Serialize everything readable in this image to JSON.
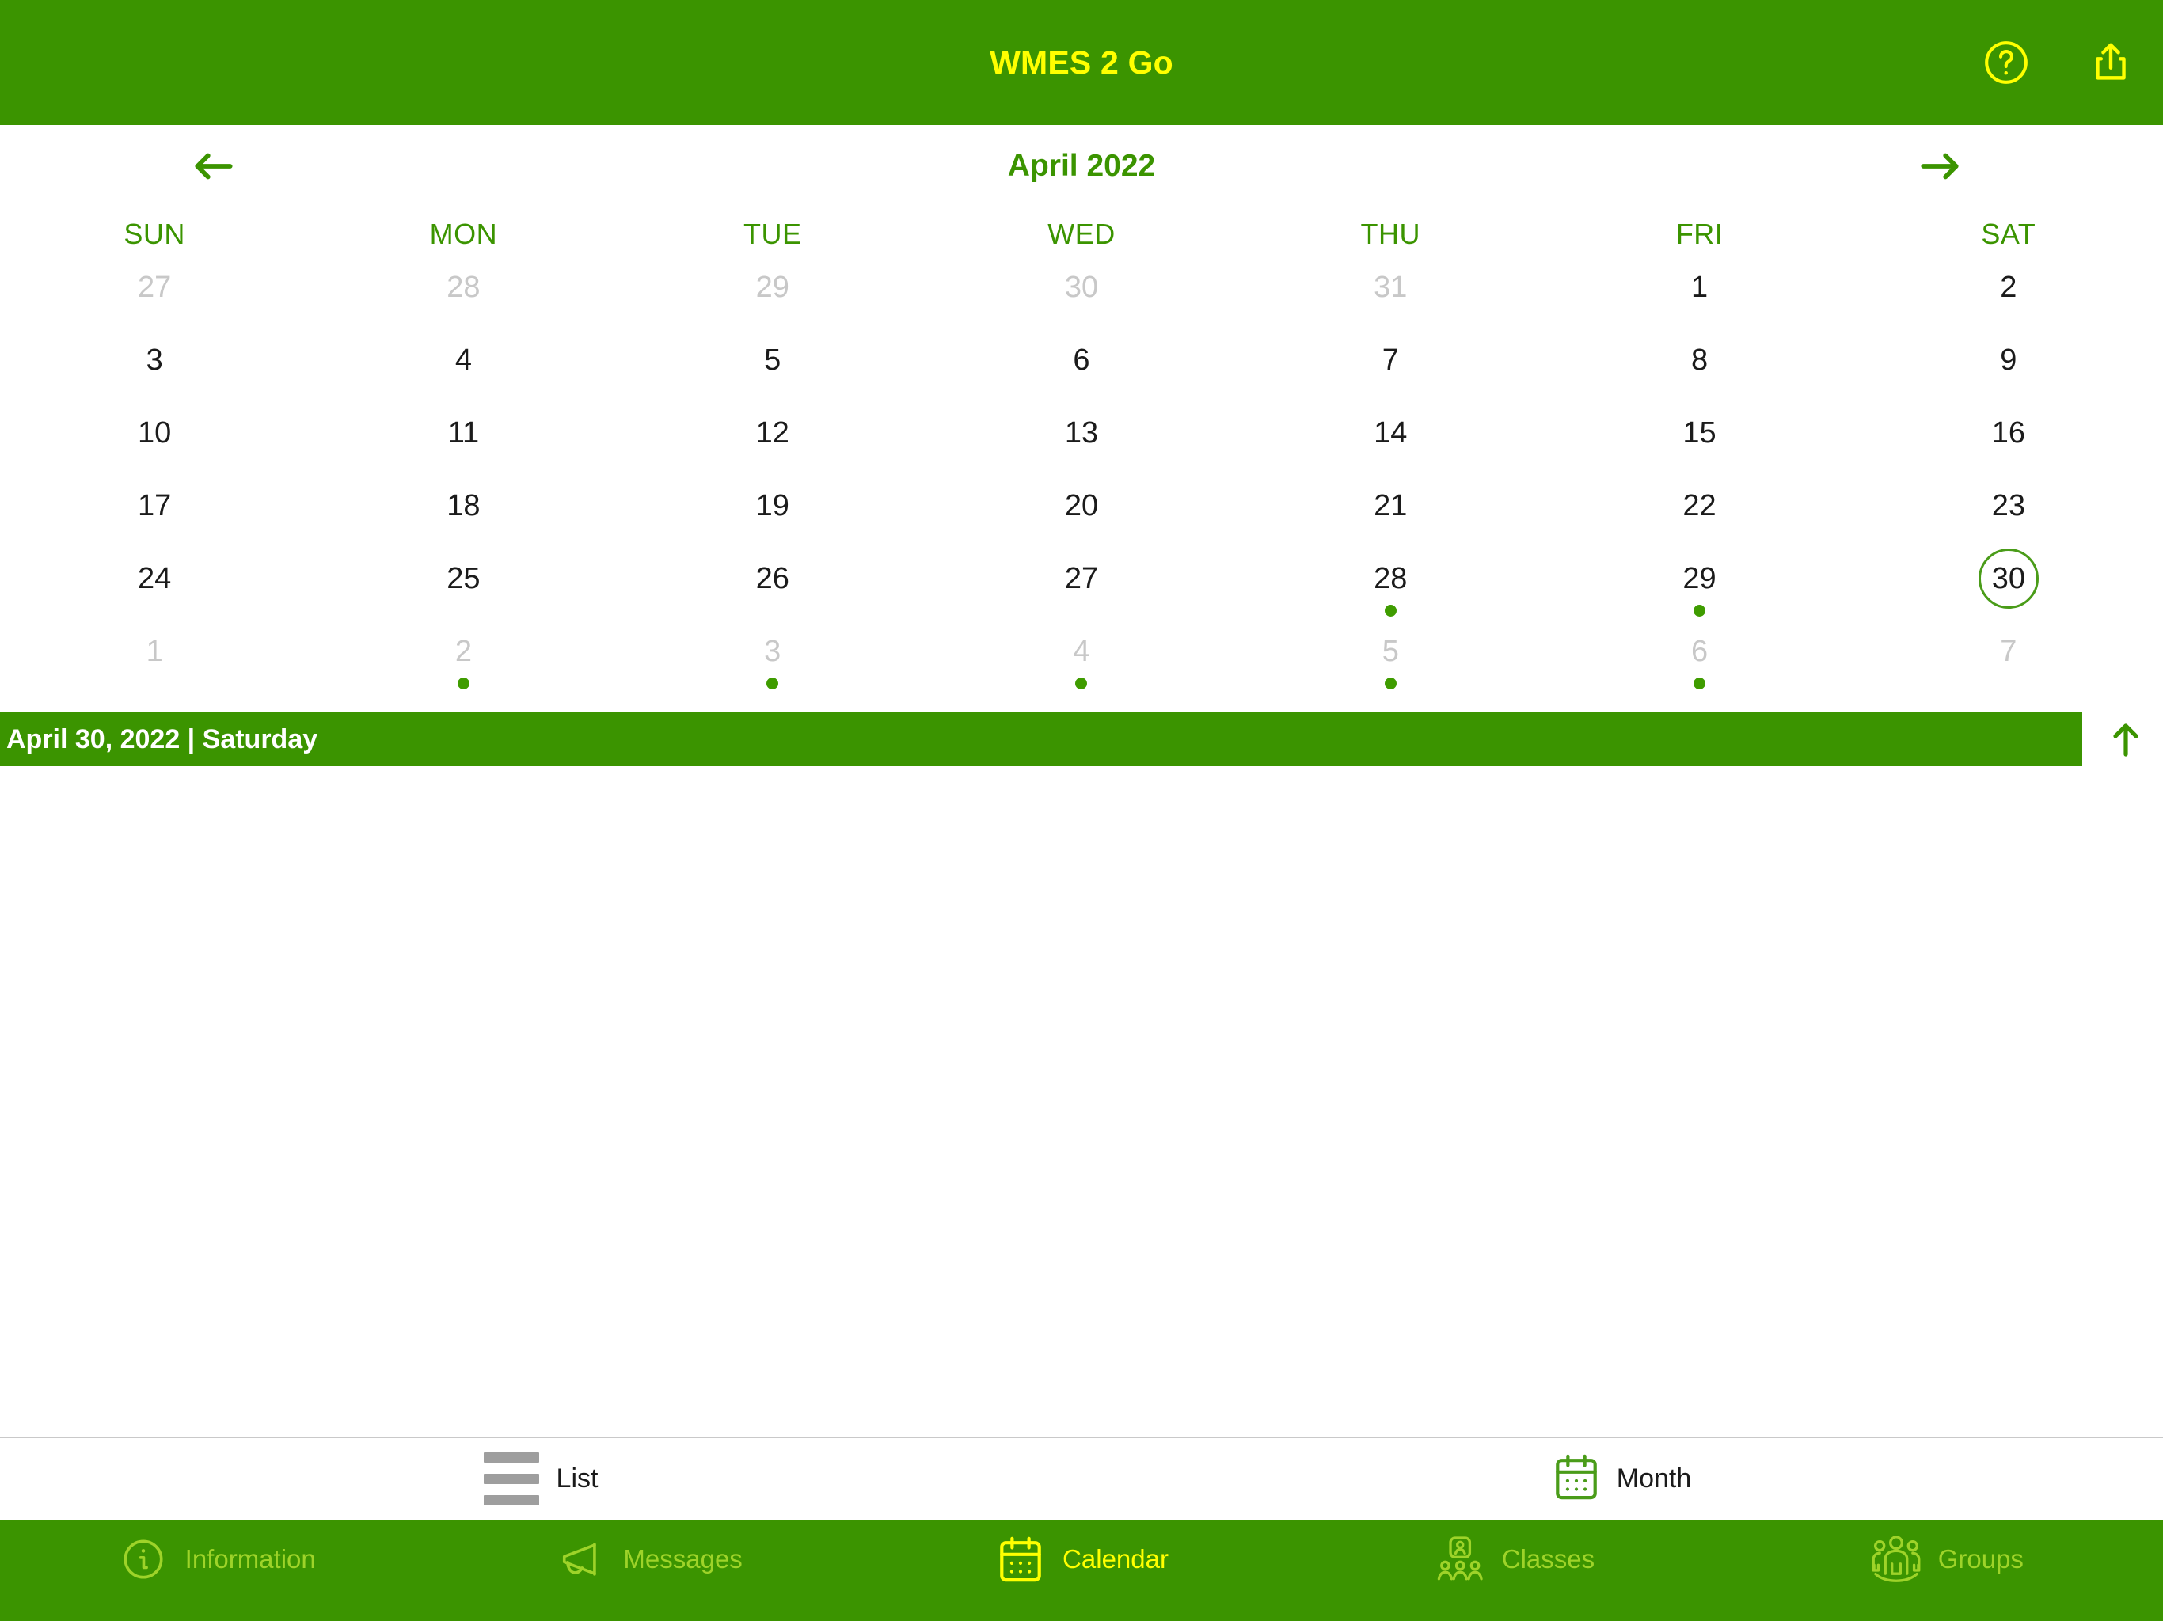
{
  "header": {
    "title": "WMES 2 Go",
    "help_icon": "question-circle-icon",
    "share_icon": "share-icon",
    "bg_color": "#3b9400",
    "text_color": "#ffff00"
  },
  "calendar": {
    "month_title": "April 2022",
    "prev_icon": "arrow-left-icon",
    "next_icon": "arrow-right-icon",
    "weekdays": [
      "SUN",
      "MON",
      "TUE",
      "WED",
      "THU",
      "FRI",
      "SAT"
    ],
    "accent_color": "#3b9400",
    "dot_color": "#3f9c00",
    "muted_color": "#c8c8c8",
    "days": [
      {
        "label": "27",
        "muted": true,
        "dot": false,
        "selected": false
      },
      {
        "label": "28",
        "muted": true,
        "dot": false,
        "selected": false
      },
      {
        "label": "29",
        "muted": true,
        "dot": false,
        "selected": false
      },
      {
        "label": "30",
        "muted": true,
        "dot": false,
        "selected": false
      },
      {
        "label": "31",
        "muted": true,
        "dot": false,
        "selected": false
      },
      {
        "label": "1",
        "muted": false,
        "dot": false,
        "selected": false
      },
      {
        "label": "2",
        "muted": false,
        "dot": false,
        "selected": false
      },
      {
        "label": "3",
        "muted": false,
        "dot": false,
        "selected": false
      },
      {
        "label": "4",
        "muted": false,
        "dot": false,
        "selected": false
      },
      {
        "label": "5",
        "muted": false,
        "dot": false,
        "selected": false
      },
      {
        "label": "6",
        "muted": false,
        "dot": false,
        "selected": false
      },
      {
        "label": "7",
        "muted": false,
        "dot": false,
        "selected": false
      },
      {
        "label": "8",
        "muted": false,
        "dot": false,
        "selected": false
      },
      {
        "label": "9",
        "muted": false,
        "dot": false,
        "selected": false
      },
      {
        "label": "10",
        "muted": false,
        "dot": false,
        "selected": false
      },
      {
        "label": "11",
        "muted": false,
        "dot": false,
        "selected": false
      },
      {
        "label": "12",
        "muted": false,
        "dot": false,
        "selected": false
      },
      {
        "label": "13",
        "muted": false,
        "dot": false,
        "selected": false
      },
      {
        "label": "14",
        "muted": false,
        "dot": false,
        "selected": false
      },
      {
        "label": "15",
        "muted": false,
        "dot": false,
        "selected": false
      },
      {
        "label": "16",
        "muted": false,
        "dot": false,
        "selected": false
      },
      {
        "label": "17",
        "muted": false,
        "dot": false,
        "selected": false
      },
      {
        "label": "18",
        "muted": false,
        "dot": false,
        "selected": false
      },
      {
        "label": "19",
        "muted": false,
        "dot": false,
        "selected": false
      },
      {
        "label": "20",
        "muted": false,
        "dot": false,
        "selected": false
      },
      {
        "label": "21",
        "muted": false,
        "dot": false,
        "selected": false
      },
      {
        "label": "22",
        "muted": false,
        "dot": false,
        "selected": false
      },
      {
        "label": "23",
        "muted": false,
        "dot": false,
        "selected": false
      },
      {
        "label": "24",
        "muted": false,
        "dot": false,
        "selected": false
      },
      {
        "label": "25",
        "muted": false,
        "dot": false,
        "selected": false
      },
      {
        "label": "26",
        "muted": false,
        "dot": false,
        "selected": false
      },
      {
        "label": "27",
        "muted": false,
        "dot": false,
        "selected": false
      },
      {
        "label": "28",
        "muted": false,
        "dot": true,
        "selected": false
      },
      {
        "label": "29",
        "muted": false,
        "dot": true,
        "selected": false
      },
      {
        "label": "30",
        "muted": false,
        "dot": false,
        "selected": true
      },
      {
        "label": "1",
        "muted": true,
        "dot": false,
        "selected": false
      },
      {
        "label": "2",
        "muted": true,
        "dot": true,
        "selected": false
      },
      {
        "label": "3",
        "muted": true,
        "dot": true,
        "selected": false
      },
      {
        "label": "4",
        "muted": true,
        "dot": true,
        "selected": false
      },
      {
        "label": "5",
        "muted": true,
        "dot": true,
        "selected": false
      },
      {
        "label": "6",
        "muted": true,
        "dot": true,
        "selected": false
      },
      {
        "label": "7",
        "muted": true,
        "dot": false,
        "selected": false
      }
    ]
  },
  "selected_date_bar": {
    "label": "April 30, 2022 | Saturday",
    "collapse_icon": "arrow-up-icon",
    "bg_color": "#3b9400",
    "text_color": "#ffffff"
  },
  "view_switch": {
    "options": [
      {
        "label": "List",
        "icon": "list-icon",
        "active": false
      },
      {
        "label": "Month",
        "icon": "calendar-icon",
        "active": true
      }
    ]
  },
  "tabbar": {
    "active_color": "#ffff00",
    "inactive_color": "#9ed329",
    "items": [
      {
        "label": "Information",
        "icon": "info-circle-icon",
        "active": false
      },
      {
        "label": "Messages",
        "icon": "megaphone-icon",
        "active": false
      },
      {
        "label": "Calendar",
        "icon": "calendar-icon",
        "active": true
      },
      {
        "label": "Classes",
        "icon": "classes-icon",
        "active": false
      },
      {
        "label": "Groups",
        "icon": "groups-icon",
        "active": false
      }
    ]
  }
}
